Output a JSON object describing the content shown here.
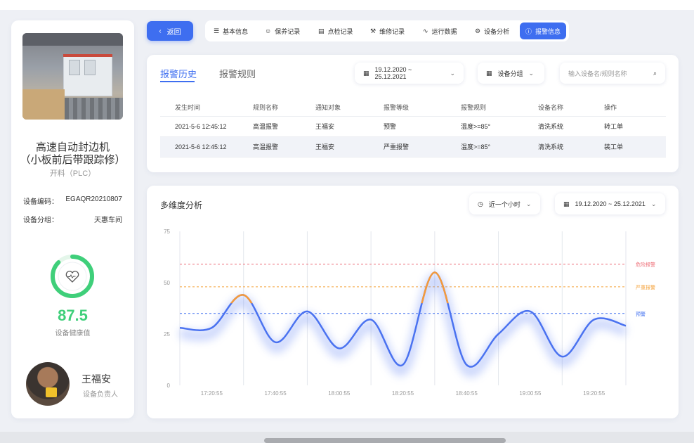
{
  "device": {
    "name_line1": "高速自动封边机",
    "name_line2": "（小板前后带跟踪修）",
    "subtitle": "开料（PLC）",
    "code_label": "设备编码：",
    "code_value": "EGAQR20210807",
    "group_label": "设备分组：",
    "group_value": "天惠车间",
    "health_score": "87.5",
    "health_score_value": 87.5,
    "health_label": "设备健康值",
    "owner_name": "王福安",
    "owner_role": "设备负责人",
    "gauge_color": "#3fcf7a"
  },
  "nav": {
    "back_label": "返回",
    "tabs": [
      {
        "label": "基本信息",
        "icon": "list-icon"
      },
      {
        "label": "保养记录",
        "icon": "smile-icon"
      },
      {
        "label": "点检记录",
        "icon": "document-icon"
      },
      {
        "label": "维修记录",
        "icon": "wrench-icon"
      },
      {
        "label": "运行数据",
        "icon": "pulse-icon"
      },
      {
        "label": "设备分析",
        "icon": "gear-icon"
      },
      {
        "label": "报警信息",
        "icon": "alert-icon",
        "active": true
      }
    ]
  },
  "history": {
    "tab_active": "报警历史",
    "tab_inactive": "报警规则",
    "date_range": "19.12.2020 ~ 25.12.2021",
    "group_select": "设备分组",
    "search_placeholder": "输入设备名/规则名称",
    "columns": [
      "发生时间",
      "规则名称",
      "通知对象",
      "报警等级",
      "报警规则",
      "设备名称",
      "操作"
    ],
    "rows": [
      [
        "2021-5-6 12:45:12",
        "高温报警",
        "王福安",
        "预警",
        "温度>=85°",
        "清洗系统",
        "转工单"
      ],
      [
        "2021-5-6 12:45:12",
        "高温报警",
        "王福安",
        "严重报警",
        "温度>=85°",
        "清洗系统",
        "装工单"
      ]
    ]
  },
  "analysis": {
    "title": "多维度分析",
    "time_select": "近一个小时",
    "date_range": "19.12.2020 ~ 25.12.2021"
  },
  "chart_data": {
    "type": "line",
    "ylim": [
      0,
      75
    ],
    "yticks": [
      0,
      25,
      50,
      75
    ],
    "xticks": [
      "17:20:55",
      "17:40:55",
      "18:00:55",
      "18:20:55",
      "18:40:55",
      "19:00:55",
      "19:20:55"
    ],
    "series": [
      {
        "x": [
          0,
          0.5,
          1,
          1.5,
          2,
          2.5,
          3,
          3.5,
          4,
          4.5,
          5,
          5.5,
          6,
          6.5,
          7
        ],
        "y": [
          28,
          28,
          44,
          21,
          36,
          18,
          32,
          10,
          55,
          10,
          25,
          36,
          14,
          32,
          29
        ]
      }
    ],
    "thresholds": [
      {
        "name": "危险报警",
        "value": 59,
        "color": "#ee6f78"
      },
      {
        "name": "严重报警",
        "value": 48,
        "color": "#f5a23a"
      },
      {
        "name": "预警",
        "value": 35,
        "color": "#3e6ef0"
      }
    ],
    "line_color": "#4a72f0",
    "highlight_color": "#f59a3a",
    "grid": "vertical"
  }
}
